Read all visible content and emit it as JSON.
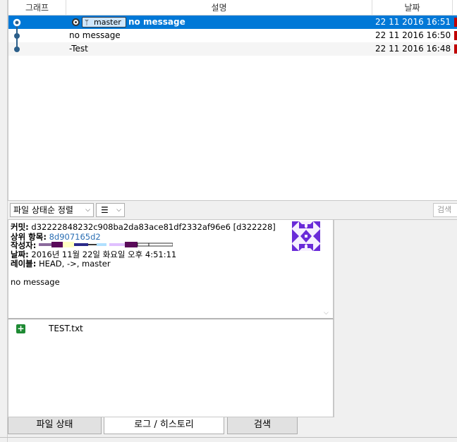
{
  "log": {
    "columns": {
      "graph": "그래프",
      "description": "설명",
      "date": "날짜"
    },
    "rows": [
      {
        "branch": "master",
        "message": "no message",
        "date": "22 11 2016 16:51"
      },
      {
        "message": "no message",
        "date": "22 11 2016 16:50"
      },
      {
        "message": "-Test",
        "date": "22 11 2016 16:48"
      }
    ]
  },
  "toolbar": {
    "sort_label": "파일 상태순 정렬",
    "search_placeholder": "검색"
  },
  "details": {
    "commit_label": "커밋:",
    "commit_value": "d32222848232c908ba2da83ace81df2332af96e6 [d322228]",
    "parent_label": "상위 항목:",
    "parent_value": "8d907165d2",
    "author_label": "작성자:",
    "date_label": "날짜:",
    "date_value": "2016년 11월 22일 화요일 오후 4:51:11",
    "labels_label": "레이블:",
    "labels_value": "HEAD, ->, master",
    "message": "no message"
  },
  "files": [
    {
      "name": "TEST.txt",
      "status": "added"
    }
  ],
  "tabs": [
    "파일 상태",
    "로그 / 히스토리",
    "검색"
  ],
  "colors": {
    "selection": "#0078d7",
    "link": "#2a6eb3",
    "added": "#1e8a33",
    "graph": "#2c5f8a"
  }
}
